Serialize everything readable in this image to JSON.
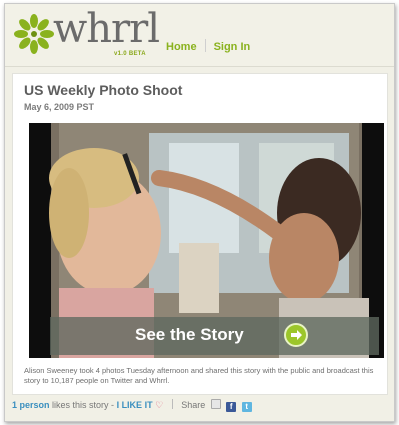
{
  "header": {
    "logo_word": "whrrl",
    "logo_sub": "v1.0 BETA",
    "nav": [
      "Home",
      "Sign In"
    ],
    "accent_color": "#8ab21e"
  },
  "story": {
    "title": "US Weekly Photo Shoot",
    "date": "May 6, 2009 PST",
    "cta_label": "See the Story",
    "cta_icon": "arrow-right-circle-icon",
    "description": "Alison Sweeney took 4 photos Tuesday afternoon and shared this story with the public and broadcast this story to 10,187 people on Twitter and Whrrl."
  },
  "footer": {
    "likes_count": "1 person",
    "likes_text": "likes this story -",
    "like_label": "I LIKE IT",
    "share_label": "Share",
    "share_icons": [
      "email-icon",
      "facebook-icon",
      "twitter-icon"
    ]
  }
}
